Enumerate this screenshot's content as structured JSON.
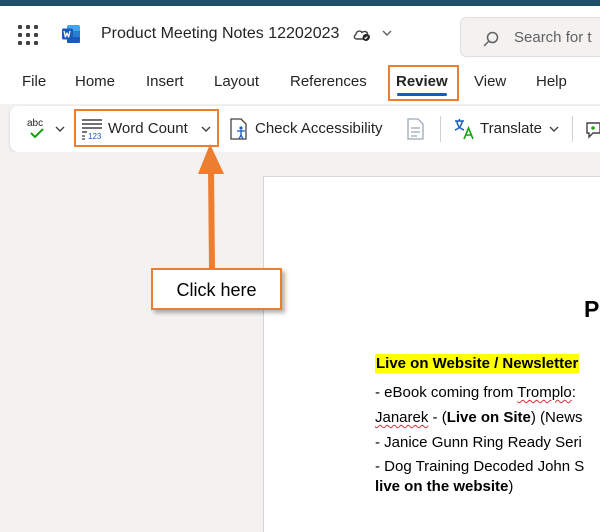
{
  "app": {
    "doc_title": "Product Meeting Notes 12202023",
    "search_placeholder": "Search for t"
  },
  "menu": {
    "items": [
      "File",
      "Home",
      "Insert",
      "Layout",
      "References",
      "Review",
      "View",
      "Help"
    ],
    "active": "Review"
  },
  "ribbon": {
    "word_count_label": "Word Count",
    "check_accessibility_label": "Check Accessibility",
    "translate_label": "Translate",
    "spelling_icon_text": "abc"
  },
  "document": {
    "heading": "P",
    "lines": {
      "l1": "Live on Website / Newsletter",
      "l2a": "- eBook coming from ",
      "l2b": "Tromplo",
      "l2c": ":",
      "l3a": "Janarek",
      "l3b": " - (",
      "l3c": "Live on Site",
      "l3d": ") (News",
      "l4": "- Janice Gunn Ring Ready Seri",
      "l5": "- Dog Training Decoded John S",
      "l6a": "live on the website",
      "l6b": ")"
    }
  },
  "annotation": {
    "callout": "Click here",
    "accent_color": "#ed7d31"
  },
  "colors": {
    "top_strip": "#1f4e6b",
    "active_tab_underline": "#185abd",
    "word_brand": "#185abd",
    "highlight": "#ffff00"
  }
}
